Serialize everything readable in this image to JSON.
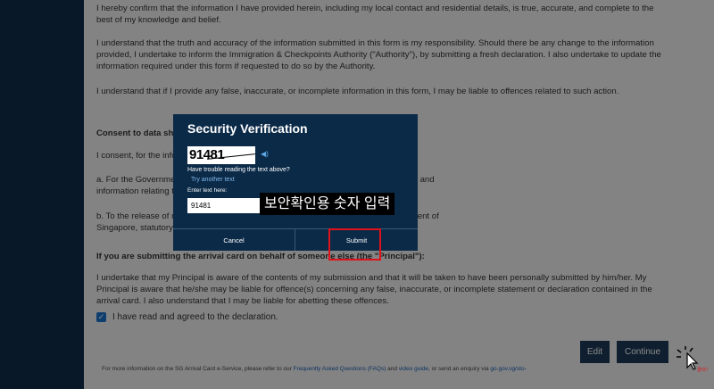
{
  "content": {
    "para1": "I hereby confirm that the information I have provided herein, including my local contact and residential details, is true, accurate, and complete to the best of my knowledge and belief.",
    "para2": "I understand that the truth and accuracy of the information submitted in this form is my responsibility. Should there be any change to the information provided, I undertake to inform the Immigration & Checkpoints Authority (\"Authority\"), by submitting a fresh declaration. I also undertake to update the information required under this form if requested to do so by the Authority.",
    "para3": "I understand that if I provide any false, inaccurate, or incomplete information in this form, I may be liable to offences related to such action.",
    "consent_heading": "Consent to data sharing",
    "consent_text": "I consent, for the information",
    "item_a_line1": "a. For the Government to obtain and verify information (including my medical records and",
    "item_a_line2": "information relating to me), where, and,",
    "item_b_line1": "b. To the release of my information (and information relating to them) to the Government of",
    "item_b_line2": "Singapore, statutory",
    "principal_heading": "If you are submitting the arrival card on behalf of someone else (the \"Principal\"):",
    "principal_text": "I undertake that my Principal is aware of the contents of my submission and that it will be taken to have been personally submitted by him/her. My Principal is aware that he/she may be liable for offence(s) concerning any false, inaccurate, or incomplete statement or declaration contained in the arrival card. I also understand that I may be liable for abetting these offences.",
    "checkbox_label": "I have read and agreed to the declaration.",
    "edit_label": "Edit",
    "continue_label": "Continue",
    "footer_prefix": "For more information on the SG Arrival Card e-Service, please refer to our",
    "footer_faq": "Frequently Asked Questions (FAQs)",
    "footer_and": "and",
    "footer_video": "video guide",
    "footer_mid": ", or send an enquiry via",
    "footer_url": "go.gov.sg/sto-"
  },
  "modal": {
    "title": "Security Verification",
    "captcha_text": "91481",
    "audio_icon": "speaker-icon",
    "trouble_text": "Have trouble reading the text above?",
    "try_another": "Try another text",
    "enter_label": "Enter text here:",
    "input_value": "91481",
    "cancel_label": "Cancel",
    "submit_label": "Submit"
  },
  "annotation": {
    "text": "보안확인용 숫자 입력",
    "click_label": "클릭!!",
    "highlight_color": "#e0131b"
  },
  "colors": {
    "sidebar": "#0f2d4a",
    "modal_bg": "#0b2a48",
    "button_bg": "#1c3a57",
    "checkbox": "#1a73c9",
    "link": "#1a5fb4"
  }
}
